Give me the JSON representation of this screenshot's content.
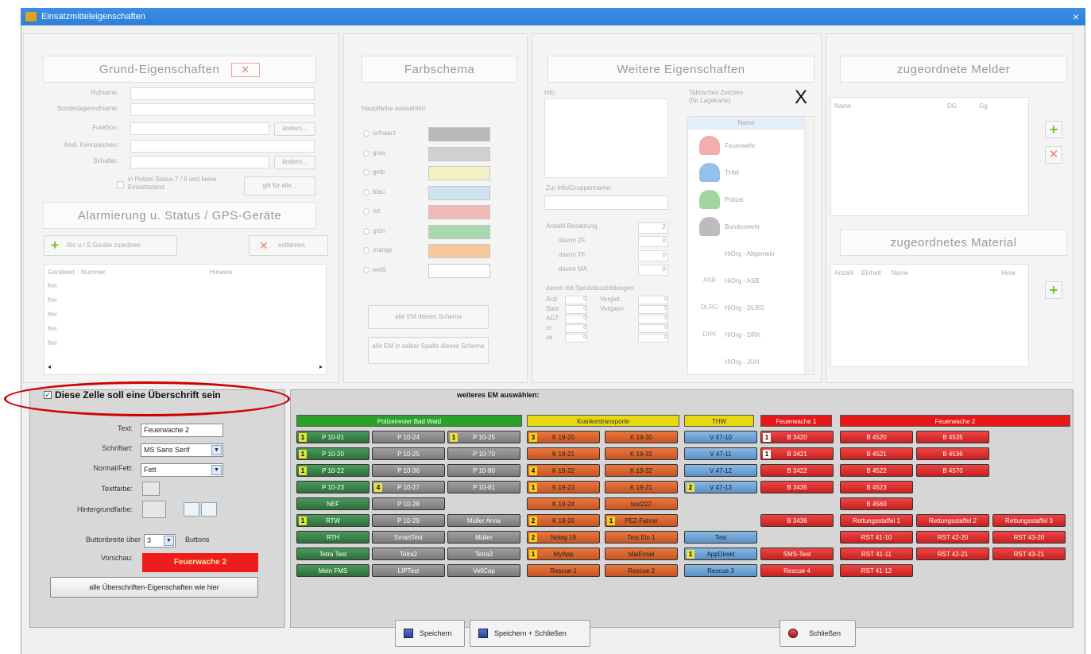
{
  "window": {
    "title": "Einsatzmitteleigenschaften",
    "close": "×"
  },
  "grund": {
    "header": "Grund-Eigenschaften",
    "labels": [
      "Rufname:",
      "Sonderlagenrufname:",
      "Funktion:",
      "Amtl. Kennzeichen:",
      "Schalter:"
    ],
    "aendern1": "ändern...",
    "aendern2": "ändern...",
    "polizei_check": "in Polizei Status 7 / 5 und keine Einsatzstand",
    "gilt_btn": "gilt für alle..."
  },
  "alarm": {
    "header": "Alarmierung u. Status / GPS-Geräte",
    "add_btn": "Ric u./ S Geräte zuordnen",
    "remove_btn": "entfernen",
    "cols": [
      "Geräteart",
      "Nummer",
      "Hinweis"
    ],
    "rows": [
      "frei",
      "frei",
      "frei",
      "frei",
      "frei"
    ]
  },
  "farb": {
    "header": "Farbschema",
    "sub": "Hauptfarbe auswählen",
    "options": [
      {
        "label": "schwarz",
        "color": "#b8b8b8"
      },
      {
        "label": "grau",
        "color": "#d0d0d0"
      },
      {
        "label": "gelb",
        "color": "#f3f0c4"
      },
      {
        "label": "blau",
        "color": "#cfe3f3"
      },
      {
        "label": "rot",
        "color": "#f2b8b8"
      },
      {
        "label": "grün",
        "color": "#a9d7b0"
      },
      {
        "label": "orange",
        "color": "#f6c89a"
      },
      {
        "label": "weiß",
        "color": "#ffffff"
      }
    ],
    "btn1": "alle EM dieses Schema",
    "btn2": "alle EM in selber Spalte dieses Schema"
  },
  "weitere": {
    "header": "Weitere Eigenschaften",
    "info": "Info",
    "zur_info": "Zur Info/Gruppenname:",
    "taktisch": "Taktisches Zeichen (für Lagekarte)",
    "name_col": "Name",
    "items": [
      "Feuerwehr",
      "THW",
      "Polizei",
      "Bundeswehr",
      "HiOrg - Allgemein",
      "HiOrg - ASB",
      "HiOrg - DLRG",
      "HiOrg - DRK",
      "HiOrg - JUH"
    ],
    "icon_labels": [
      "ASB",
      "DLRG",
      "DRK"
    ],
    "anzahl": "Anzahl Besatzung",
    "anzahl_val": "2",
    "davon": [
      "davon ZF",
      "davon TF",
      "davon MA"
    ],
    "davon_vals": [
      "0",
      "0",
      "0"
    ],
    "spezial": "davon mit Spezialausbildungen",
    "spez_l": [
      "Arzt",
      "Sani",
      "AGT",
      "re",
      "ve"
    ],
    "spez_r": [
      "Vergiet",
      "Vergaen"
    ],
    "zero": "0"
  },
  "melder": {
    "header": "zugeordnete Melder",
    "cols": [
      "Name",
      "DG",
      "Gg"
    ]
  },
  "material": {
    "header": "zugeordnetes Material",
    "cols": [
      "Anzahl",
      "Einheit",
      "Name",
      "Hinw"
    ]
  },
  "left_form": {
    "checkbox_label": "Diese Zelle soll eine Überschrift sein",
    "text_label": "Text:",
    "text_value": "Feuerwache 2",
    "font_label": "Schriftart:",
    "font_value": "MS Sans Serif",
    "style_label": "Normal/Fett:",
    "style_value": "Fett",
    "textcolor_label": "Textfarbe:",
    "bgcolor_label": "Hintergrundfarbe:",
    "width_label": "Buttonbreite über",
    "width_value": "3",
    "width_unit": "Buttons",
    "preview_label": "Vorschau:",
    "preview_value": "Feuerwache 2",
    "apply_btn": "alle Überschriften-Eigenschaften wie hier"
  },
  "grid": {
    "title": "weiteres EM auswählen:",
    "headers": [
      {
        "label": "Polizeirevier Bad Wald",
        "color": "#2aa22a"
      },
      {
        "label": "Krankentransporte",
        "color": "#e8d810"
      },
      {
        "label": "THW",
        "color": "#e8d810"
      },
      {
        "label": "Feuerwache 1",
        "color": "#e81818"
      },
      {
        "label": "Feuerwache 2",
        "color": "#e81818"
      }
    ],
    "rows": [
      [
        [
          "g",
          "P 10-01",
          "1"
        ],
        [
          "gr",
          "P 10-24",
          ""
        ],
        [
          "gr",
          "P 10-25",
          "1"
        ],
        [
          "o",
          "K 19-20",
          "3"
        ],
        [
          "o",
          "K 19-30",
          ""
        ],
        [
          "b",
          "V 47-10",
          ""
        ],
        [
          "r",
          "B 3420",
          "1"
        ],
        [
          "r",
          "B 4520",
          ""
        ],
        [
          "r",
          "B 4535",
          ""
        ],
        [
          "",
          ""
        ]
      ],
      [
        [
          "g",
          "P 10-20",
          "1"
        ],
        [
          "gr",
          "P 10-25",
          ""
        ],
        [
          "gr",
          "P 10-70",
          ""
        ],
        [
          "o",
          "K 19-21",
          ""
        ],
        [
          "o",
          "K 19-31",
          ""
        ],
        [
          "b",
          "V 47-11",
          ""
        ],
        [
          "r",
          "B 3421",
          "1"
        ],
        [
          "r",
          "B 4521",
          ""
        ],
        [
          "r",
          "B 4536",
          ""
        ],
        [
          "",
          ""
        ]
      ],
      [
        [
          "g",
          "P 10-22",
          "1"
        ],
        [
          "gr",
          "P 10-36",
          ""
        ],
        [
          "gr",
          "P 10-80",
          ""
        ],
        [
          "o",
          "K 19-22",
          "4"
        ],
        [
          "o",
          "K 19-32",
          ""
        ],
        [
          "b",
          "V 47-12",
          ""
        ],
        [
          "r",
          "B 3422",
          ""
        ],
        [
          "r",
          "B 4522",
          ""
        ],
        [
          "r",
          "B 4570",
          ""
        ],
        [
          "",
          ""
        ]
      ],
      [
        [
          "g",
          "P 10-23",
          ""
        ],
        [
          "gr",
          "P 10-27",
          "4"
        ],
        [
          "gr",
          "P 10-81",
          ""
        ],
        [
          "o",
          "K 19-23",
          "1"
        ],
        [
          "o",
          "K 19-21",
          ""
        ],
        [
          "b",
          "V 47-13",
          "2"
        ],
        [
          "r",
          "B 3435",
          ""
        ],
        [
          "r",
          "B 4523",
          ""
        ],
        [
          "",
          ""
        ],
        [
          "",
          ""
        ]
      ],
      [
        [
          "g",
          "NEF",
          ""
        ],
        [
          "gr",
          "P 10-28",
          ""
        ],
        [
          "",
          ""
        ],
        [
          "o",
          "K 19-24",
          ""
        ],
        [
          "o",
          "test222",
          ""
        ],
        [
          "",
          ""
        ],
        [
          "",
          ""
        ],
        [
          "r",
          "B 4560",
          ""
        ],
        [
          "",
          ""
        ],
        [
          "",
          ""
        ]
      ],
      [
        [
          "g",
          "RTW",
          "1"
        ],
        [
          "gr",
          "P 10-29",
          ""
        ],
        [
          "gr",
          "Müller Anna",
          ""
        ],
        [
          "o",
          "K 19-26",
          "2"
        ],
        [
          "o",
          "PEZ-Fahrer",
          "1"
        ],
        [
          "",
          ""
        ],
        [
          "r",
          "B 3436",
          ""
        ],
        [
          "r",
          "Rettungsstaffel 1",
          ""
        ],
        [
          "r",
          "Rettungsstaffel 2",
          ""
        ],
        [
          "r",
          "Rettungsstaffel 3",
          ""
        ]
      ],
      [
        [
          "g",
          "RTH",
          ""
        ],
        [
          "gr",
          "SmartTest",
          ""
        ],
        [
          "gr",
          "Müller",
          ""
        ],
        [
          "o",
          "Nebig 19",
          "2"
        ],
        [
          "o",
          "Test Ein 1",
          ""
        ],
        [
          "b",
          "Test",
          ""
        ],
        [
          "",
          ""
        ],
        [
          "r",
          "RST 41-10",
          ""
        ],
        [
          "r",
          "RST 42-20",
          ""
        ],
        [
          "r",
          "RST 43-20",
          ""
        ]
      ],
      [
        [
          "g",
          "Tetra Test",
          ""
        ],
        [
          "gr",
          "Tetra2",
          ""
        ],
        [
          "gr",
          "Tetra3",
          ""
        ],
        [
          "o",
          "MyApp",
          "1"
        ],
        [
          "o",
          "MaiEmail",
          ""
        ],
        [
          "b",
          "AppDirekt",
          "1"
        ],
        [
          "r",
          "SMS-Test",
          ""
        ],
        [
          "r",
          "RST 41-11",
          ""
        ],
        [
          "r",
          "RST 42-21",
          ""
        ],
        [
          "r",
          "RST 43-21",
          ""
        ]
      ],
      [
        [
          "g",
          "Mein FMS",
          ""
        ],
        [
          "gr",
          "LIPTest",
          ""
        ],
        [
          "gr",
          "VellCap",
          ""
        ],
        [
          "o",
          "Rescue 1",
          ""
        ],
        [
          "o",
          "Rescue 2",
          ""
        ],
        [
          "b",
          "Rescue 3",
          ""
        ],
        [
          "r",
          "Rescue 4",
          ""
        ],
        [
          "r",
          "RST 41-12",
          ""
        ],
        [
          "",
          ""
        ],
        [
          "",
          ""
        ]
      ]
    ]
  },
  "footer": {
    "save": "Speichern",
    "save_close": "Speichern + Schließen",
    "close": "Schließen"
  }
}
